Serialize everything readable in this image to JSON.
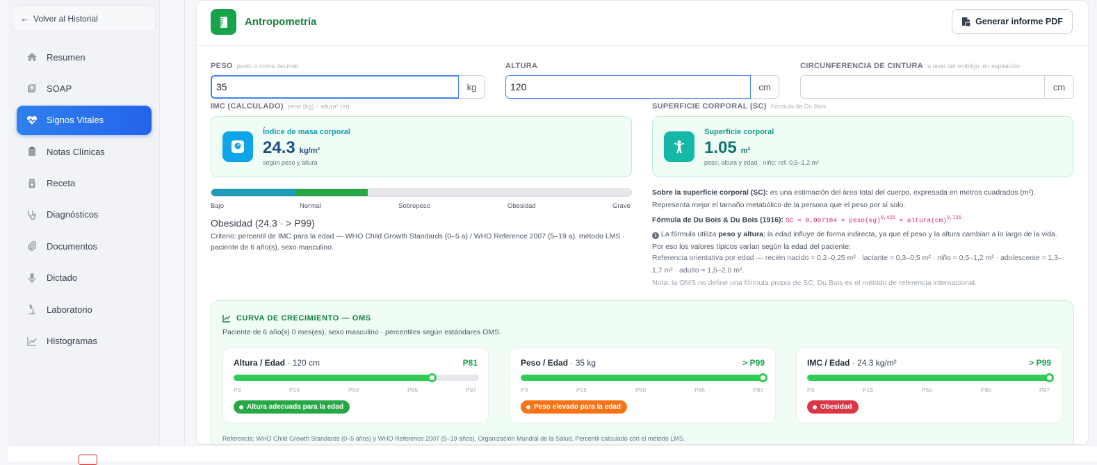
{
  "sidebar": {
    "back_label": "Volver al Historial",
    "items": [
      {
        "label": "Resumen",
        "icon": "home-icon"
      },
      {
        "label": "SOAP",
        "icon": "medical-file-icon"
      },
      {
        "label": "Signos Vitales",
        "icon": "heart-pulse-icon",
        "active": true
      },
      {
        "label": "Notas Clínicas",
        "icon": "clipboard-icon"
      },
      {
        "label": "Receta",
        "icon": "prescription-icon"
      },
      {
        "label": "Diagnósticos",
        "icon": "stethoscope-icon"
      },
      {
        "label": "Documentos",
        "icon": "paperclip-icon"
      },
      {
        "label": "Dictado",
        "icon": "microphone-icon"
      },
      {
        "label": "Laboratorio",
        "icon": "microscope-icon"
      },
      {
        "label": "Histogramas",
        "icon": "chart-line-icon"
      }
    ]
  },
  "section": {
    "title": "Antropometría",
    "pdf_button": "Generar informe PDF"
  },
  "fields": {
    "peso": {
      "label": "PESO",
      "hint": "punto o coma decimal",
      "value": "35",
      "unit": "kg"
    },
    "altura": {
      "label": "ALTURA",
      "value": "120",
      "unit": "cm"
    },
    "cintura": {
      "label": "CIRCUNFERENCIA DE CINTURA",
      "hint": "a nivel del ombligo, en espiración",
      "value": "",
      "unit": "cm"
    }
  },
  "imc": {
    "section_label": "IMC (CALCULADO)",
    "section_hint": "peso (kg) ÷ altura² (m)",
    "title": "Índice de masa corporal",
    "value": "24.3",
    "unit": "kg/m²",
    "sub": "según peso y altura",
    "scale_labels": [
      "Bajo",
      "Normal",
      "Sobrepeso",
      "Obesidad",
      "Grave"
    ],
    "classification": "Obesidad (24.3 · > P99)",
    "criteria": "Criterio: percentil de IMC para la edad — WHO Child Growth Standards (0–5 a) / WHO Reference 2007 (5–19 a), método LMS · paciente de 6 año(s), sexo masculino."
  },
  "sc": {
    "section_label": "SUPERFICIE CORPORAL (SC)",
    "section_hint": "Fórmula de Du Bois",
    "title": "Superficie corporal",
    "value": "1.05",
    "unit": "m²",
    "sub": "peso, altura y edad · niño: ref. 0,5–1,2 m²",
    "about_bold": "Sobre la superficie corporal (SC):",
    "about_text": " es una estimación del área total del cuerpo, expresada en metros cuadrados (m²). Representa mejor el tamaño metabólico de la persona que el peso por sí solo.",
    "formula_label": "Fórmula de Du Bois & Du Bois (1916):",
    "formula_base": "SC = 0,007184 × peso(kg)",
    "formula_exp1": "0,425",
    "formula_mid": " × altura(cm)",
    "formula_exp2": "0,725",
    "info_pre": "La fórmula utiliza ",
    "info_bold": "peso y altura",
    "info_post": "; la edad influye de forma indirecta, ya que el peso y la altura cambian a lo largo de la vida. Por eso los valores típicos varían según la edad del paciente:",
    "reference": "Referencia orientativa por edad — recién nacido ≈ 0,2–0,25 m² · lactante ≈ 0,3–0,5 m² · niño ≈ 0,5–1,2 m² · adolescente ≈ 1,3–1,7 m² · adulto ≈ 1,5–2,0 m².",
    "note": "Nota: la OMS no define una fórmula propia de SC; Du Bois es el método de referencia internacional."
  },
  "growth": {
    "title": "CURVA DE CRECIMIENTO — OMS",
    "subtitle": "Paciente de 6 año(s) 0 mes(es), sexo masculino · percentiles según estándares OMS.",
    "tick_labels": [
      "P3",
      "P15",
      "P50",
      "P85",
      "P97"
    ],
    "cards": [
      {
        "title": "Altura / Edad",
        "value": "· 120 cm",
        "percentile": "P81",
        "fill_fraction": 0.81,
        "badge": "Altura adecuada para la edad",
        "badge_color": "#28a745"
      },
      {
        "title": "Peso / Edad",
        "value": "· 35 kg",
        "percentile": "> P99",
        "fill_fraction": 0.99,
        "badge": "Peso elevado para la edad",
        "badge_color": "#f97316"
      },
      {
        "title": "IMC / Edad",
        "value": "· 24.3 kg/m²",
        "percentile": "> P99",
        "fill_fraction": 0.99,
        "badge": "Obesidad",
        "badge_color": "#dc3545"
      }
    ],
    "reference": "Referencia: WHO Child Growth Standards (0–5 años) y WHO Reference 2007 (5–19 años), Organización Mundial de la Salud. Percentil calculado con el método LMS."
  }
}
